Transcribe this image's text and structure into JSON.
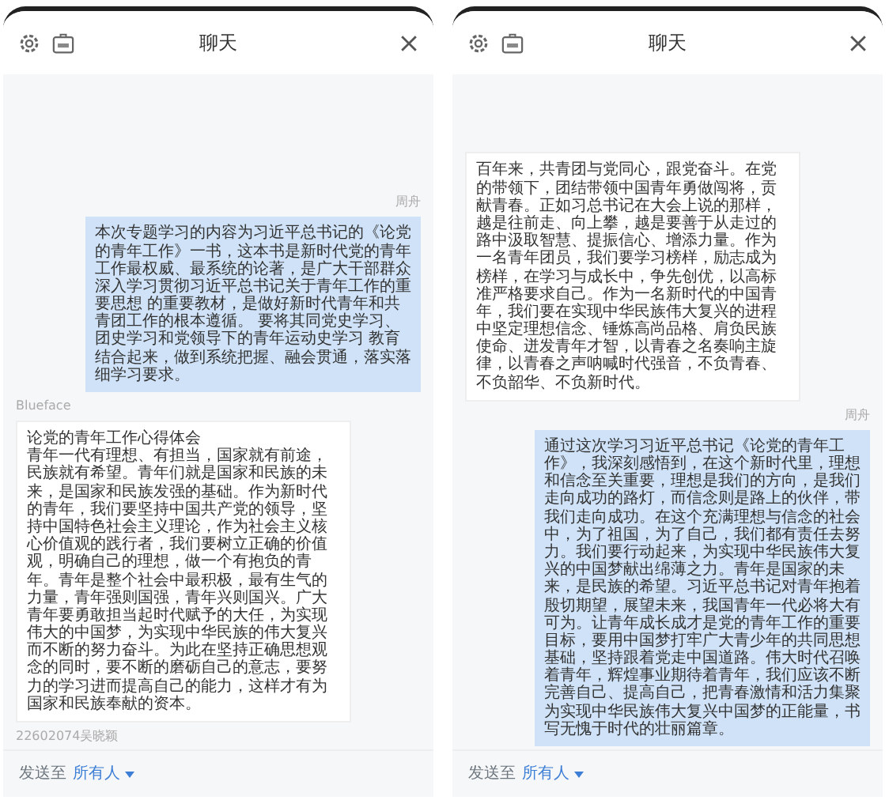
{
  "panels": [
    {
      "title": "聊天",
      "messages": [
        {
          "kind": "sent",
          "sender": "周舟",
          "text": "本次专题学习的内容为习近平总书记的《论党的青年工作》一书，这本书是新时代党的青年工作最权威、最系统的论著，是广大干部群众深入学习贯彻习近平总书记关于青年工作的重要思想 的重要教材，是做好新时代青年和共青团工作的根本遵循。 要将其同党史学习、团史学习和党领导下的青年运动史学习 教育结合起来，做到系统把握、融会贯通，落实落细学习要求。"
        },
        {
          "kind": "received",
          "sender": "Blueface",
          "heading": "论党的青年工作心得体会",
          "text": "青年一代有理想、有担当，国家就有前途，民族就有希望。青年们就是国家和民族的未来，是国家和民族发强的基础。作为新时代的青年，我们要坚持中国共产党的领导，坚持中国特色社会主义理论，作为社会主义核心价值观的践行者，我们要树立正确的价值观，明确自己的理想，做一个有抱负的青年。青年是整个社会中最积极，最有生气的力量，青年强则国强，青年兴则国兴。广大青年要勇敢担当起时代赋予的大任，为实现伟大的中国梦，为实现中华民族的伟大复兴而不断的努力奋斗。为此在坚持正确思想观念的同时，要不断的磨砺自己的意志，要努力的学习进而提高自己的能力，这样才有为国家和民族奉献的资本。"
        },
        {
          "kind": "received",
          "sender": "22602074吴晓颖"
        }
      ],
      "footer": {
        "label": "发送至",
        "recipient": "所有人"
      }
    },
    {
      "title": "聊天",
      "messages": [
        {
          "kind": "received",
          "text": "百年来，共青团与党同心，跟党奋斗。在党的带领下，团结带领中国青年勇做闯将，贡献青春。正如习总书记在大会上说的那样，越是往前走、向上攀，越是要善于从走过的路中汲取智慧、提振信心、增添力量。作为一名青年团员，我们要学习榜样，励志成为榜样，在学习与成长中，争先创优，以高标准严格要求自己。作为一名新时代的中国青年，我们要在实现中华民族伟大复兴的进程中坚定理想信念、锤炼高尚品格、肩负民族使命、迸发青年才智，以青春之名奏响主旋律，以青春之声呐喊时代强音，不负青春、不负韶华、不负新时代。"
        },
        {
          "kind": "sent",
          "sender": "周舟",
          "text": "通过这次学习习近平总书记《论党的青年工作》，我深刻感悟到，在这个新时代里，理想和信念至关重要，理想是我们的方向，是我们走向成功的路灯，而信念则是路上的伙伴，带我们走向成功。在这个充满理想与信念的社会中，为了祖国，为了自己，我们都有责任去努力。我们要行动起来，为实现中华民族伟大复兴的中国梦献出绵薄之力。青年是国家的未来，是民族的希望。习近平总书记对青年抱着殷切期望，展望未来，我国青年一代必将大有可为。让青年成长成才是党的青年工作的重要目标，要用中国梦打牢广大青少年的共同思想基础，坚持跟着党走中国道路。伟大时代召唤着青年，辉煌事业期待着青年，我们应该不断完善自己、提高自己，把青春激情和活力集聚为实现中华民族伟大复兴中国梦的正能量，书写无愧于时代的壮丽篇章。"
        }
      ],
      "footer": {
        "label": "发送至",
        "recipient": "所有人"
      }
    }
  ]
}
